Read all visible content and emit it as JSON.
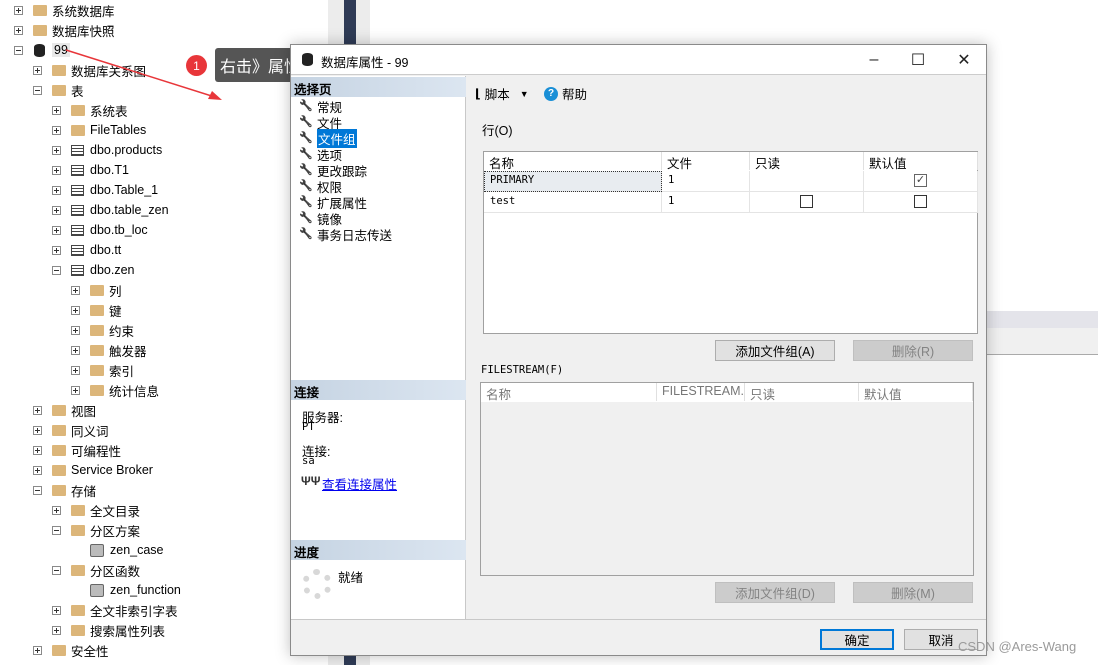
{
  "tree": [
    {
      "level": 0,
      "exp": "plus",
      "icon": "folder",
      "label": "系统数据库"
    },
    {
      "level": 0,
      "exp": "plus",
      "icon": "folder",
      "label": "数据库快照"
    },
    {
      "level": 0,
      "exp": "minus",
      "icon": "database",
      "label": "99"
    },
    {
      "level": 1,
      "exp": "plus",
      "icon": "folder",
      "label": "数据库关系图"
    },
    {
      "level": 1,
      "exp": "minus",
      "icon": "folder",
      "label": "表"
    },
    {
      "level": 2,
      "exp": "plus",
      "icon": "folder",
      "label": "系统表"
    },
    {
      "level": 2,
      "exp": "plus",
      "icon": "folder",
      "label": "FileTables"
    },
    {
      "level": 2,
      "exp": "plus",
      "icon": "table",
      "label": "dbo.products"
    },
    {
      "level": 2,
      "exp": "plus",
      "icon": "table",
      "label": "dbo.T1"
    },
    {
      "level": 2,
      "exp": "plus",
      "icon": "table",
      "label": "dbo.Table_1"
    },
    {
      "level": 2,
      "exp": "plus",
      "icon": "table",
      "label": "dbo.table_zen"
    },
    {
      "level": 2,
      "exp": "plus",
      "icon": "table",
      "label": "dbo.tb_loc"
    },
    {
      "level": 2,
      "exp": "plus",
      "icon": "table",
      "label": "dbo.tt"
    },
    {
      "level": 2,
      "exp": "minus",
      "icon": "table",
      "label": "dbo.zen"
    },
    {
      "level": 3,
      "exp": "plus",
      "icon": "folder",
      "label": "列"
    },
    {
      "level": 3,
      "exp": "plus",
      "icon": "folder",
      "label": "键"
    },
    {
      "level": 3,
      "exp": "plus",
      "icon": "folder",
      "label": "约束"
    },
    {
      "level": 3,
      "exp": "plus",
      "icon": "folder",
      "label": "触发器"
    },
    {
      "level": 3,
      "exp": "plus",
      "icon": "folder",
      "label": "索引"
    },
    {
      "level": 3,
      "exp": "plus",
      "icon": "folder",
      "label": "统计信息"
    },
    {
      "level": 1,
      "exp": "plus",
      "icon": "folder",
      "label": "视图"
    },
    {
      "level": 1,
      "exp": "plus",
      "icon": "folder",
      "label": "同义词"
    },
    {
      "level": 1,
      "exp": "plus",
      "icon": "folder",
      "label": "可编程性"
    },
    {
      "level": 1,
      "exp": "plus",
      "icon": "folder",
      "label": "Service Broker"
    },
    {
      "level": 1,
      "exp": "minus",
      "icon": "folder",
      "label": "存储"
    },
    {
      "level": 2,
      "exp": "plus",
      "icon": "folder",
      "label": "全文目录"
    },
    {
      "level": 2,
      "exp": "minus",
      "icon": "folder",
      "label": "分区方案"
    },
    {
      "level": 3,
      "exp": "none",
      "icon": "partition",
      "label": "zen_case"
    },
    {
      "level": 2,
      "exp": "minus",
      "icon": "folder",
      "label": "分区函数"
    },
    {
      "level": 3,
      "exp": "none",
      "icon": "partition",
      "label": "zen_function"
    },
    {
      "level": 2,
      "exp": "plus",
      "icon": "folder",
      "label": "全文非索引字表"
    },
    {
      "level": 2,
      "exp": "plus",
      "icon": "folder",
      "label": "搜索属性列表"
    },
    {
      "level": 1,
      "exp": "plus",
      "icon": "folder",
      "label": "安全性"
    }
  ],
  "annotation": {
    "number": "1",
    "text": "右击》属性",
    "color": "#e8363a"
  },
  "dialog": {
    "title": "数据库属性 - 99",
    "select_page_header": "选择页",
    "pages": [
      "常规",
      "文件",
      "文件组",
      "选项",
      "更改跟踪",
      "权限",
      "扩展属性",
      "镜像",
      "事务日志传送"
    ],
    "selected_page": "文件组",
    "connection": {
      "header": "连接",
      "server_label": "服务器:",
      "server_value": "PT",
      "connection_label": "连接:",
      "connection_value": "sa",
      "view_link": "查看连接属性"
    },
    "progress": {
      "header": "进度",
      "status": "就绪"
    },
    "toolbar": {
      "script": "脚本",
      "help": "帮助"
    },
    "rows_label": "行(O)",
    "rows_grid": {
      "columns": [
        "名称",
        "文件",
        "只读",
        "默认值"
      ],
      "rows": [
        {
          "name": "PRIMARY",
          "files": "1",
          "readonly": null,
          "default": true
        },
        {
          "name": "test",
          "files": "1",
          "readonly": false,
          "default": false
        }
      ]
    },
    "rows_add": "添加文件组(A)",
    "rows_remove": "删除(R)",
    "filestream_label": "FILESTREAM(F)",
    "filestream_grid": {
      "columns": [
        "名称",
        "FILESTREAM...",
        "只读",
        "默认值"
      ]
    },
    "fs_add": "添加文件组(D)",
    "fs_remove": "删除(M)",
    "ok": "确定",
    "cancel": "取消"
  },
  "watermark": "CSDN @Ares-Wang"
}
